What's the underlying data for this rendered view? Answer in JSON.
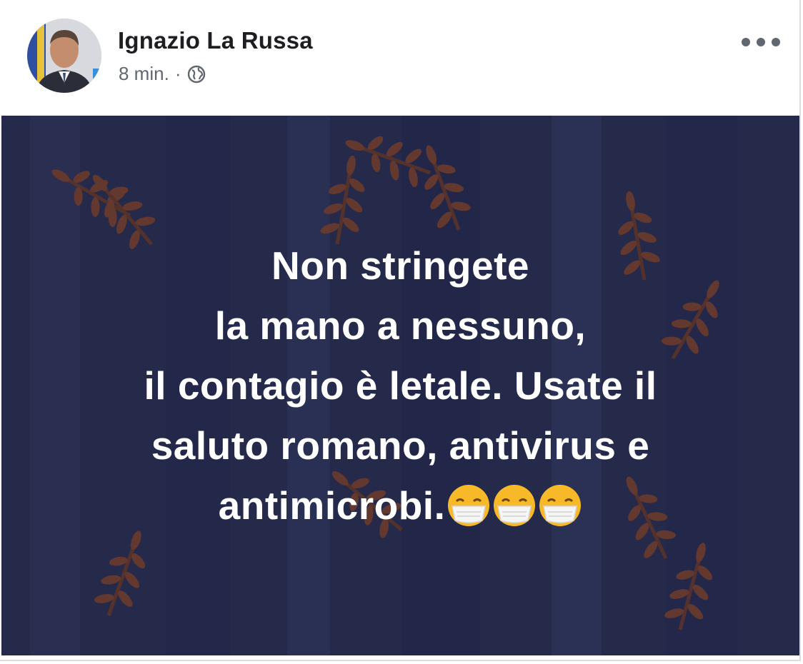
{
  "post": {
    "author": "Ignazio La Russa",
    "time": "8 min.",
    "separator": "·",
    "privacy_icon": "globe-icon",
    "more_icon": "more-options-icon",
    "text_lines": [
      "Non stringete",
      "la mano a nessuno,",
      "il contagio è letale. Usate il",
      "saluto romano, antivirus e",
      "antimicrobi."
    ],
    "emoji": [
      "face-with-medical-mask",
      "face-with-medical-mask",
      "face-with-medical-mask"
    ],
    "colors": {
      "background": "#252a4a",
      "text": "#ffffff",
      "author": "#1c1e21",
      "meta": "#606770",
      "decor": "#6b3a2c"
    }
  }
}
